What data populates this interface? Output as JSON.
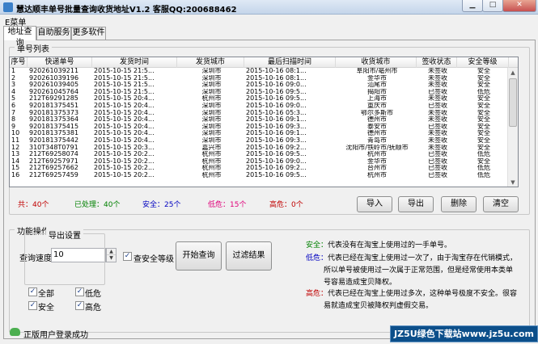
{
  "window": {
    "title": "慧达顺丰单号批量查询收货地址V1.2 客服QQ:200688462",
    "menu": "E菜单"
  },
  "tabs": [
    "地址查询",
    "自助服务",
    "更多软件"
  ],
  "list": {
    "legend": "单号列表",
    "columns": [
      "序号",
      "快递单号",
      "发货时间",
      "发货城市",
      "最后扫描时间",
      "收货城市",
      "签收状态",
      "安全等级"
    ],
    "rows": [
      [
        "1",
        "920261039211",
        "2015-10-15 21:5...",
        "深圳市",
        "2015-10-16 08:1...",
        "阜阳市/亳州市",
        "未签收",
        "安全"
      ],
      [
        "2",
        "920261039196",
        "2015-10-15 21:5...",
        "深圳市",
        "2015-10-16 08:1...",
        "金华市",
        "未签收",
        "安全"
      ],
      [
        "3",
        "920261039405",
        "2015-10-15 21:5...",
        "深圳市",
        "2015-10-16 09:0...",
        "汕尾市",
        "未签收",
        "安全"
      ],
      [
        "4",
        "920261045764",
        "2015-10-15 21:5...",
        "深圳市",
        "2015-10-16 09:5...",
        "揭阳市",
        "已签收",
        "低危"
      ],
      [
        "5",
        "212T69291285",
        "2015-10-15 20:4...",
        "杭州市",
        "2015-10-16 09:5...",
        "上海市",
        "未签收",
        "安全"
      ],
      [
        "6",
        "920181375451",
        "2015-10-15 20:4...",
        "深圳市",
        "2015-10-16 09:0...",
        "重庆市",
        "已签收",
        "安全"
      ],
      [
        "7",
        "920181375373",
        "2015-10-15 20:4...",
        "深圳市",
        "2015-10-16 05:3...",
        "鄂尔多斯市",
        "未签收",
        "安全"
      ],
      [
        "8",
        "920181375364",
        "2015-10-15 20:4...",
        "深圳市",
        "2015-10-16 09:1...",
        "德州市",
        "未签收",
        "安全"
      ],
      [
        "9",
        "920181375415",
        "2015-10-15 20:4...",
        "深圳市",
        "2015-10-16 09:3...",
        "泰安市",
        "已签收",
        "安全"
      ],
      [
        "10",
        "920181375381",
        "2015-10-15 20:4...",
        "深圳市",
        "2015-10-16 09:1...",
        "德州市",
        "未签收",
        "安全"
      ],
      [
        "11",
        "920181375442",
        "2015-10-15 20:4...",
        "深圳市",
        "2015-10-16 09:3...",
        "青岛市",
        "未签收",
        "安全"
      ],
      [
        "12",
        "310T348T0791",
        "2015-10-15 20:3...",
        "嘉兴市",
        "2015-10-16 09:2...",
        "沈阳市/铁岭市/抚顺市",
        "未签收",
        "安全"
      ],
      [
        "13",
        "212T69258074",
        "2015-10-15 20:2...",
        "杭州市",
        "2015-10-16 09:5...",
        "杭州市",
        "已签收",
        "低危"
      ],
      [
        "14",
        "212T69257971",
        "2015-10-15 20:2...",
        "杭州市",
        "2015-10-16 09:0...",
        "金华市",
        "已签收",
        "安全"
      ],
      [
        "15",
        "212T69257662",
        "2015-10-15 20:2...",
        "杭州市",
        "2015-10-16 09:2...",
        "台州市",
        "已签收",
        "低危"
      ],
      [
        "16",
        "212T69257459",
        "2015-10-15 20:2...",
        "杭州市",
        "2015-10-16 09:5...",
        "杭州市",
        "已签收",
        "低危"
      ]
    ]
  },
  "stats": {
    "total": "共：40个",
    "processed": "已处理：40个",
    "safe": "安全：25个",
    "low_risk": "低危：15个",
    "high_risk": "高危：0个"
  },
  "buttons": {
    "import": "导入",
    "export": "导出",
    "delete": "删除",
    "clear": "清空",
    "start_query": "开始查询",
    "filter": "过滤结果"
  },
  "ops": {
    "legend": "功能操作",
    "speed_label": "查询速度：",
    "speed_value": "10",
    "check_safety_label": "查安全等级",
    "export_legend": "导出设置",
    "export_options": [
      "全部",
      "低危",
      "安全",
      "高危"
    ]
  },
  "info": {
    "safe_key": "安全：",
    "safe_text": "代表没有在淘宝上使用过的一手单号。",
    "low_key": "低危：",
    "low_text_1": "代表已经在淘宝上使用过一次了，由于淘宝存在代销模式，",
    "low_text_2": "所以单号被使用过一次属于正常范围，但是经常使用本类单",
    "low_text_3": "号容易造成宝贝降权。",
    "high_key": "高危：",
    "high_text_1": "代表已经在淘宝上使用过多次，这种单号极度不安全。很容",
    "high_text_2": "易就造成宝贝被降权判虚假交易。"
  },
  "status": {
    "text": "正版用户登录成功"
  },
  "watermark": "JZ5U绿色下载站www.jz5u.com",
  "colors": {
    "total": "#c00000",
    "processed": "#008000",
    "safe": "#0000c0",
    "low_risk": "#e0007a",
    "high_risk": "#c00000",
    "info_safe": "#008000",
    "info_low": "#0000c0",
    "info_high": "#c00000"
  },
  "icons": {
    "app": "app-icon",
    "status": "user-check-icon"
  }
}
